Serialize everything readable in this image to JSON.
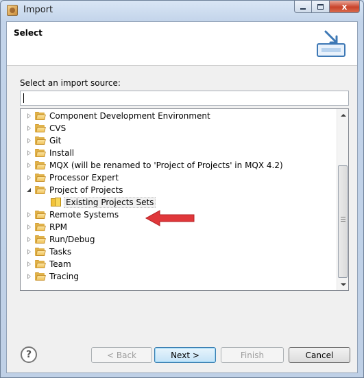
{
  "window": {
    "title": "Import",
    "controls": {
      "minimize": "minimize",
      "maximize": "maximize",
      "close": "x"
    }
  },
  "header": {
    "title": "Select",
    "banner_icon": "import-wizard-icon"
  },
  "source_picker": {
    "label": "Select an import source:",
    "filter_value": ""
  },
  "tree": {
    "items": [
      {
        "label": "Component Development Environment",
        "expanded": false,
        "level": 0,
        "icon": "folder-icon"
      },
      {
        "label": "CVS",
        "expanded": false,
        "level": 0,
        "icon": "folder-icon"
      },
      {
        "label": "Git",
        "expanded": false,
        "level": 0,
        "icon": "folder-icon"
      },
      {
        "label": "Install",
        "expanded": false,
        "level": 0,
        "icon": "folder-icon"
      },
      {
        "label": "MQX (will be renamed to 'Project of Projects' in MQX 4.2)",
        "expanded": false,
        "level": 0,
        "icon": "folder-icon"
      },
      {
        "label": "Processor Expert",
        "expanded": false,
        "level": 0,
        "icon": "folder-icon"
      },
      {
        "label": "Project of Projects",
        "expanded": true,
        "level": 0,
        "icon": "folder-icon"
      },
      {
        "label": "Existing Projects Sets",
        "expanded": false,
        "level": 1,
        "icon": "project-set-icon",
        "selected": true
      },
      {
        "label": "Remote Systems",
        "expanded": false,
        "level": 0,
        "icon": "folder-icon"
      },
      {
        "label": "RPM",
        "expanded": false,
        "level": 0,
        "icon": "folder-icon"
      },
      {
        "label": "Run/Debug",
        "expanded": false,
        "level": 0,
        "icon": "folder-icon"
      },
      {
        "label": "Tasks",
        "expanded": false,
        "level": 0,
        "icon": "folder-icon"
      },
      {
        "label": "Team",
        "expanded": false,
        "level": 0,
        "icon": "folder-icon"
      },
      {
        "label": "Tracing",
        "expanded": false,
        "level": 0,
        "icon": "folder-icon"
      }
    ]
  },
  "buttons": {
    "help": "?",
    "back": "< Back",
    "next": "Next >",
    "finish": "Finish",
    "cancel": "Cancel"
  },
  "colors": {
    "annotation_arrow": "#e0373a",
    "window_frame": "#c3d4ea",
    "close_button": "#c9432b"
  }
}
